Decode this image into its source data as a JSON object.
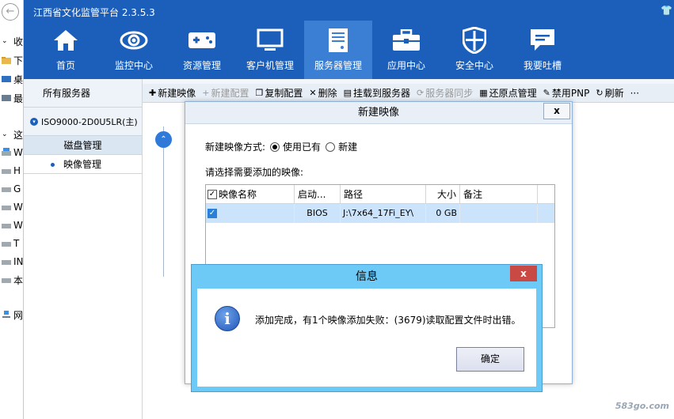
{
  "explorer": {
    "items": [
      {
        "label": "收藏",
        "icon": "star-icon"
      },
      {
        "label": "下",
        "icon": "download-folder-icon"
      },
      {
        "label": "桌",
        "icon": "desktop-icon"
      },
      {
        "label": "最",
        "icon": "recent-icon"
      },
      {
        "label": "这台",
        "icon": "computer-icon"
      },
      {
        "label": "W",
        "icon": "windows-drive-icon"
      },
      {
        "label": "H",
        "icon": "drive-icon"
      },
      {
        "label": "G",
        "icon": "drive-icon"
      },
      {
        "label": "W",
        "icon": "drive-icon"
      },
      {
        "label": "W",
        "icon": "drive-icon"
      },
      {
        "label": "T",
        "icon": "drive-icon"
      },
      {
        "label": "IN",
        "icon": "drive-icon"
      },
      {
        "label": "本",
        "icon": "drive-icon"
      },
      {
        "label": "网络",
        "icon": "network-icon"
      }
    ]
  },
  "app": {
    "title": "江西省文化监管平台 2.3.5.3",
    "nav": [
      {
        "label": "首页",
        "icon": "home-icon"
      },
      {
        "label": "监控中心",
        "icon": "eye-icon"
      },
      {
        "label": "资源管理",
        "icon": "gamepad-icon"
      },
      {
        "label": "客户机管理",
        "icon": "monitor-icon"
      },
      {
        "label": "服务器管理",
        "icon": "server-icon",
        "active": true
      },
      {
        "label": "应用中心",
        "icon": "toolbox-icon"
      },
      {
        "label": "安全中心",
        "icon": "shield-icon"
      },
      {
        "label": "我要吐槽",
        "icon": "feedback-icon"
      }
    ]
  },
  "tree": {
    "header": "所有服务器",
    "server": "ISO9000-2D0U5LR(主)",
    "group": "磁盘管理",
    "leaf": "映像管理"
  },
  "toolbar": {
    "items": [
      {
        "label": "新建映像",
        "icon": "+",
        "disabled": false
      },
      {
        "label": "新建配置",
        "icon": "+",
        "disabled": true
      },
      {
        "label": "复制配置",
        "icon": "❐",
        "disabled": false
      },
      {
        "label": "删除",
        "icon": "✕",
        "disabled": false
      },
      {
        "label": "挂载到服务器",
        "icon": "▤",
        "disabled": false
      },
      {
        "label": "服务器同步",
        "icon": "⟳",
        "disabled": true
      },
      {
        "label": "还原点管理",
        "icon": "▦",
        "disabled": false
      },
      {
        "label": "禁用PNP",
        "icon": "✎",
        "disabled": false
      },
      {
        "label": "刷新",
        "icon": "↻",
        "disabled": false
      },
      {
        "label": "···",
        "icon": "",
        "disabled": false
      }
    ]
  },
  "dialog_new_image": {
    "title": "新建映像",
    "close": "x",
    "mode_label": "新建映像方式:",
    "mode_options": [
      "使用已有",
      "新建"
    ],
    "select_label": "请选择需要添加的映像:",
    "columns": [
      "映像名称",
      "启动...",
      "路径",
      "大小",
      "备注"
    ],
    "rows": [
      {
        "name": "",
        "boot": "BIOS",
        "path": "J:\\7x64_17Fi_EY\\",
        "size": "0 GB",
        "note": ""
      }
    ]
  },
  "dialog_info": {
    "title": "信息",
    "close": "x",
    "icon": "info-icon",
    "message": "添加完成，有1个映像添加失败：(3679)读取配置文件时出错。",
    "ok": "确定"
  },
  "watermark": "583go.com"
}
